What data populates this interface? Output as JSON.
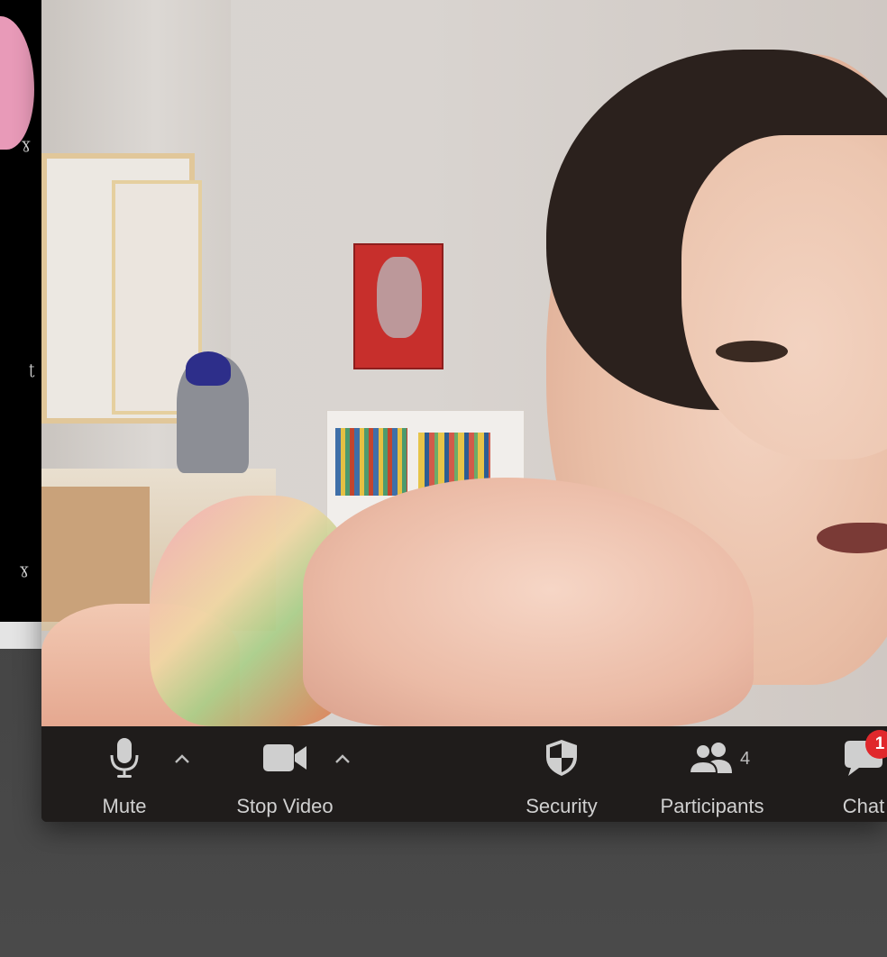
{
  "toolbar": {
    "mute_label": "Mute",
    "stop_video_label": "Stop Video",
    "security_label": "Security",
    "participants_label": "Participants",
    "participants_count": "4",
    "chat_label": "Chat",
    "chat_badge": "1"
  },
  "icons": {
    "mute": "microphone-icon",
    "video": "video-camera-icon",
    "security": "shield-icon",
    "participants": "people-icon",
    "chat": "chat-bubble-icon",
    "caret": "chevron-up-icon"
  },
  "colors": {
    "toolbar_bg": "#1f1c1b",
    "label": "#d0d0d0",
    "badge": "#e0282c"
  }
}
